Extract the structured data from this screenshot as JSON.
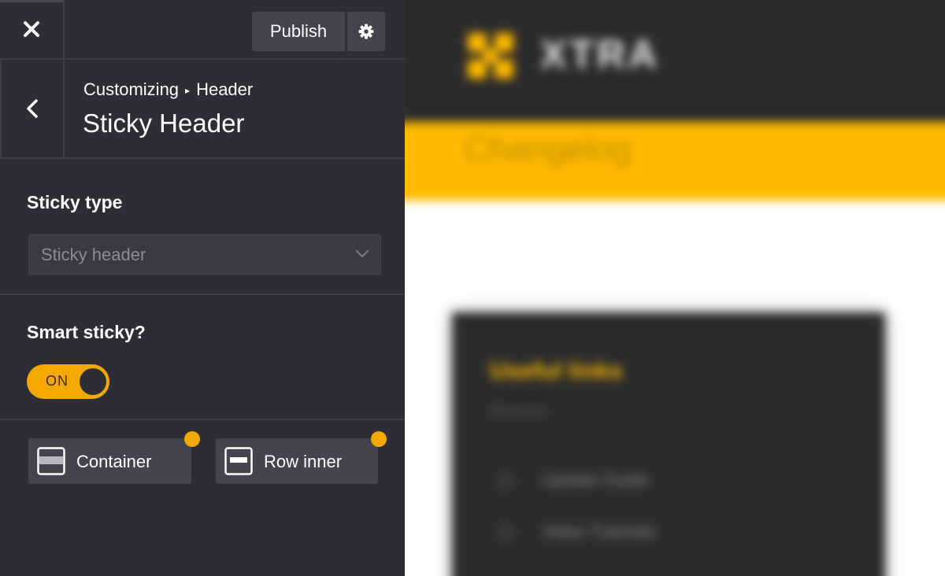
{
  "toolbar": {
    "close_icon": "close-icon",
    "publish_label": "Publish",
    "settings_icon": "gear-icon"
  },
  "section": {
    "back_icon": "chevron-left-icon",
    "breadcrumb": [
      "Customizing",
      "Header"
    ],
    "breadcrumb_separator": "▸",
    "title": "Sticky Header"
  },
  "controls": {
    "sticky_type": {
      "label": "Sticky type",
      "value": "Sticky header"
    },
    "smart_sticky": {
      "label": "Smart sticky?",
      "state": "ON"
    },
    "tabs": [
      {
        "label": "Container",
        "icon": "container-icon",
        "modified": true
      },
      {
        "label": "Row inner",
        "icon": "row-inner-icon",
        "modified": true
      }
    ]
  },
  "preview": {
    "logo_text": "XTRA",
    "band_text": "Changelog",
    "card_title": "Useful links",
    "card_subtitle": "Resources",
    "card_items": [
      "Update Guide",
      "Video Tutorials"
    ]
  },
  "colors": {
    "sidebar_bg": "#2e2d36",
    "button_bg": "#45444e",
    "accent": "#f5a800",
    "preview_accent": "#ffba00"
  }
}
